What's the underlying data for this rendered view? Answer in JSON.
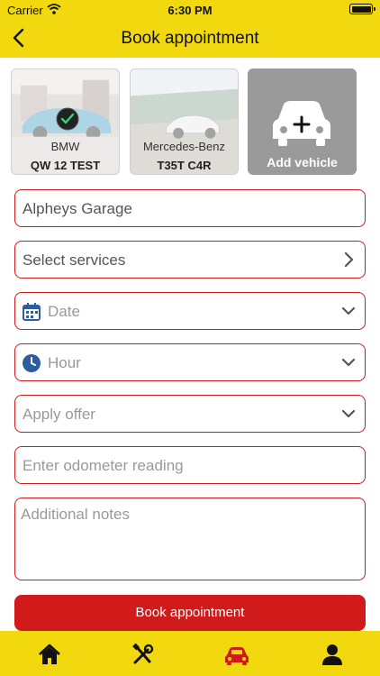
{
  "status_bar": {
    "carrier": "Carrier",
    "time": "6:30 PM"
  },
  "header": {
    "title": "Book appointment"
  },
  "vehicles": [
    {
      "make": "BMW",
      "plate": "QW 12 TEST",
      "selected": true
    },
    {
      "make": "Mercedes-Benz",
      "plate": "T35T C4R",
      "selected": false
    }
  ],
  "add_vehicle": {
    "label": "Add vehicle"
  },
  "form": {
    "garage": "Alpheys Garage",
    "services": "Select services",
    "date": "Date",
    "hour": "Hour",
    "offer": "Apply offer",
    "odometer_placeholder": "Enter odometer reading",
    "notes_placeholder": "Additional notes"
  },
  "book_button": "Book appointment",
  "tabs": [
    {
      "name": "home",
      "icon": "home-icon",
      "active": false
    },
    {
      "name": "services",
      "icon": "tools-icon",
      "active": false
    },
    {
      "name": "vehicles",
      "icon": "car-icon",
      "active": true
    },
    {
      "name": "account",
      "icon": "person-icon",
      "active": false
    }
  ],
  "colors": {
    "accent": "#f2d90f",
    "primary": "#d11a1a",
    "active_tab": "#d11a1a"
  }
}
